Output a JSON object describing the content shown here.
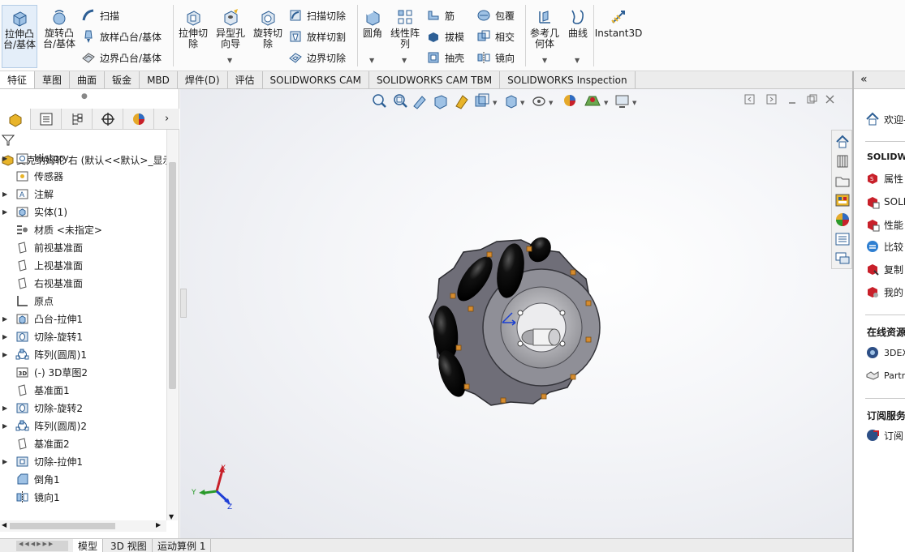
{
  "ribbon": {
    "extrude_boss": "拉伸凸台/基体",
    "revolve_boss": "旋转凸台/基体",
    "sweep": "扫描",
    "loft_boss": "放样凸台/基体",
    "boundary_boss": "边界凸台/基体",
    "extrude_cut": "拉伸切除",
    "hole_wizard": "异型孔向导",
    "revolve_cut": "旋转切除",
    "swept_cut": "扫描切除",
    "lofted_cut": "放样切割",
    "boundary_cut": "边界切除",
    "fillet": "圆角",
    "linear_pattern": "线性阵列",
    "rib": "筋",
    "draft": "拔模",
    "shell": "抽壳",
    "wrap": "包覆",
    "intersect": "相交",
    "mirror": "镜向",
    "ref_geometry": "参考几何体",
    "curves": "曲线",
    "instant3d": "Instant3D"
  },
  "tabs": [
    "特征",
    "草图",
    "曲面",
    "钣金",
    "MBD",
    "焊件(D)",
    "评估",
    "SOLIDWORKS CAM",
    "SOLIDWORKS CAM TBM",
    "SOLIDWORKS Inspection"
  ],
  "tree": {
    "root": "麦克纳姆轮 右  (默认<<默认>_显示",
    "items": [
      {
        "label": "History",
        "expand": true
      },
      {
        "label": "传感器",
        "expand": false
      },
      {
        "label": "注解",
        "expand": true
      },
      {
        "label": "实体(1)",
        "expand": true
      },
      {
        "label": "材质 <未指定>",
        "expand": false
      },
      {
        "label": "前视基准面",
        "expand": false
      },
      {
        "label": "上视基准面",
        "expand": false
      },
      {
        "label": "右视基准面",
        "expand": false
      },
      {
        "label": "原点",
        "expand": false
      },
      {
        "label": "凸台-拉伸1",
        "expand": true
      },
      {
        "label": "切除-旋转1",
        "expand": true
      },
      {
        "label": "阵列(圆周)1",
        "expand": true
      },
      {
        "label": "(-) 3D草图2",
        "expand": false
      },
      {
        "label": "基准面1",
        "expand": false
      },
      {
        "label": "切除-旋转2",
        "expand": true
      },
      {
        "label": "阵列(圆周)2",
        "expand": true
      },
      {
        "label": "基准面2",
        "expand": false
      },
      {
        "label": "切除-拉伸1",
        "expand": true
      },
      {
        "label": "倒角1",
        "expand": false
      },
      {
        "label": "镜向1",
        "expand": false
      }
    ]
  },
  "bottom_tabs": [
    "模型",
    "3D 视图",
    "运动算例 1"
  ],
  "triad": {
    "x": "X",
    "y": "Y",
    "z": "Z"
  },
  "task_pane": {
    "welcome": "欢迎-",
    "section1": "SOLIDWO",
    "items1": [
      "属性",
      "SOLI",
      "性能",
      "比较",
      "复制",
      "我的"
    ],
    "section2": "在线资源",
    "items2": [
      "3DEX",
      "Partr"
    ],
    "section3": "订阅服务",
    "items3": [
      "订阅"
    ]
  },
  "colors": {
    "accent": "#1f66b8",
    "icon_red": "#c8202a",
    "selected_bg": "#e4eef9"
  }
}
